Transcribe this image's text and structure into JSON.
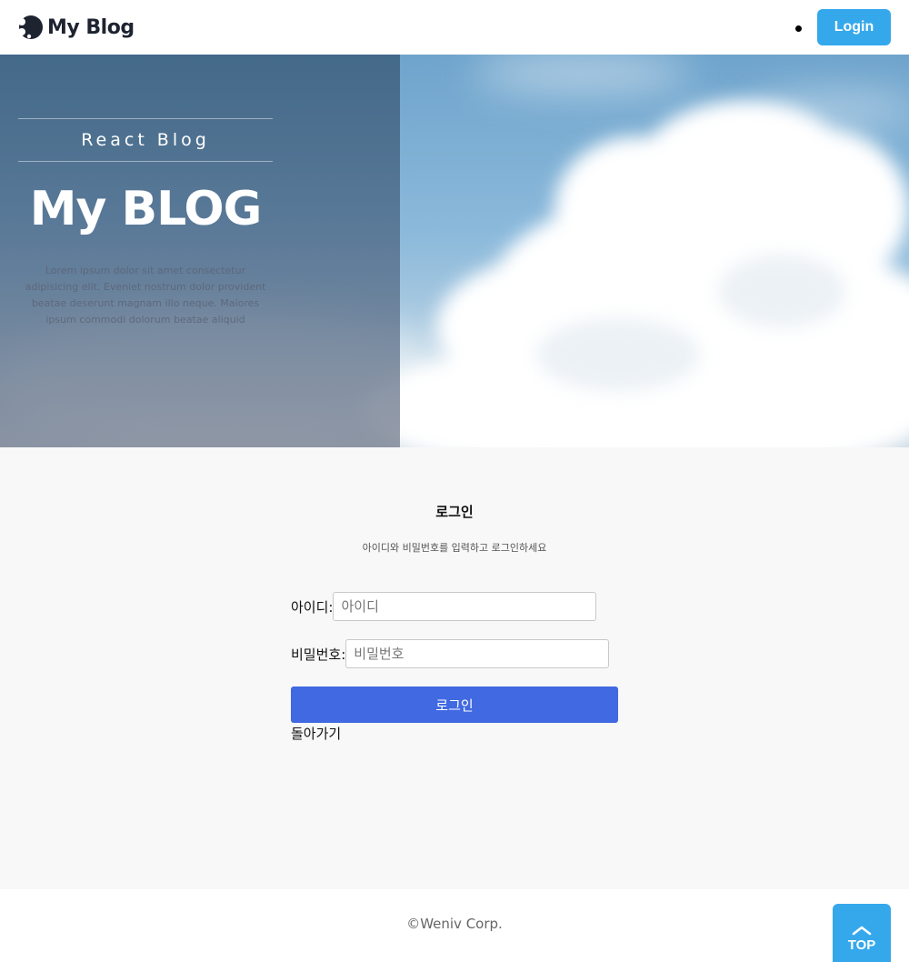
{
  "header": {
    "brand": "My Blog",
    "login_label": "Login"
  },
  "hero": {
    "subtitle": "React Blog",
    "title": "My BLOG",
    "description": "Lorem ipsum dolor sit amet consectetur adipisicing elit. Eveniet nostrum dolor provident beatae deserunt magnam illo neque. Maiores ipsum commodi dolorum beatae aliquid laboriosam est."
  },
  "login": {
    "title": "로그인",
    "description": "아이디와 비밀번호를 입력하고 로그인하세요",
    "id_label": "아이디:",
    "id_placeholder": "아이디",
    "password_label": "비밀번호:",
    "password_placeholder": "비밀번호",
    "submit_label": "로그인",
    "back_label": "돌아가기"
  },
  "footer": {
    "copyright": "©Weniv Corp.",
    "top_label": "TOP"
  },
  "colors": {
    "accent": "#35a8ec",
    "submit": "#4169e1"
  }
}
